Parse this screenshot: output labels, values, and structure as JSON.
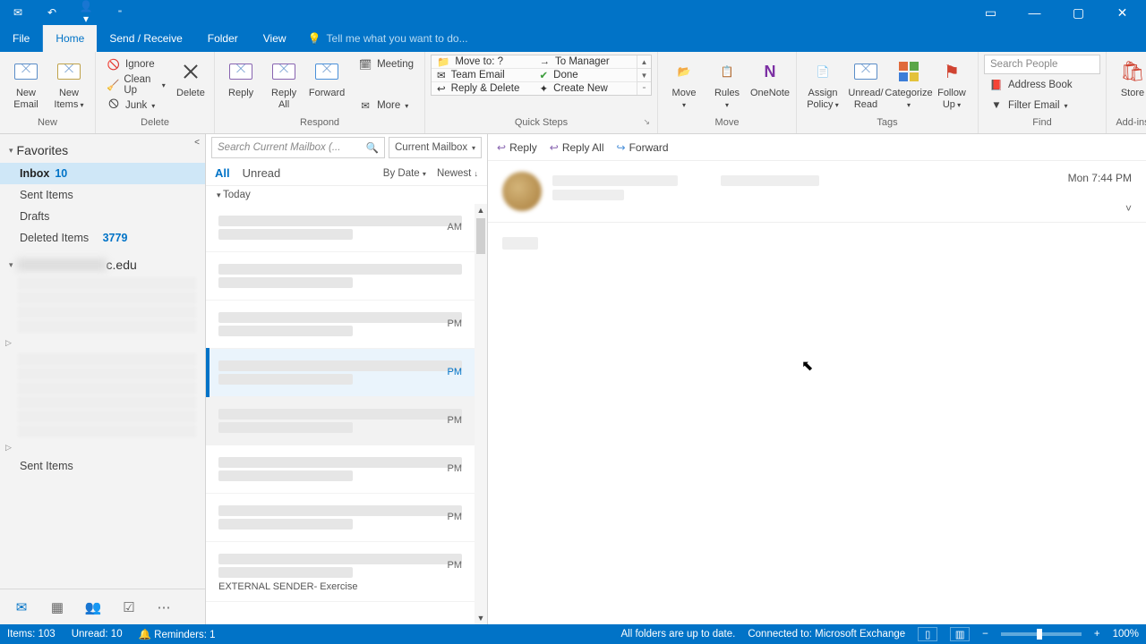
{
  "titlebar": {
    "app_hint": "Outlook"
  },
  "ribbon": {
    "file": "File",
    "tabs": [
      {
        "label": "Home",
        "active": true
      },
      {
        "label": "Send / Receive"
      },
      {
        "label": "Folder"
      },
      {
        "label": "View"
      }
    ],
    "tellme": "Tell me what you want to do..."
  },
  "groups": {
    "new": {
      "label": "New",
      "new_email": "New\nEmail",
      "new_items": "New\nItems"
    },
    "delete": {
      "label": "Delete",
      "ignore": "Ignore",
      "cleanup": "Clean Up",
      "junk": "Junk",
      "delete_btn": "Delete"
    },
    "respond": {
      "label": "Respond",
      "reply": "Reply",
      "reply_all": "Reply\nAll",
      "forward": "Forward",
      "meeting": "Meeting",
      "more": "More"
    },
    "quicksteps": {
      "label": "Quick Steps",
      "left": [
        "Move to: ?",
        "Team Email",
        "Reply & Delete"
      ],
      "right": [
        "To Manager",
        "Done",
        "Create New"
      ]
    },
    "move": {
      "label": "Move",
      "move": "Move",
      "rules": "Rules",
      "onenote": "OneNote"
    },
    "tags": {
      "label": "Tags",
      "assign": "Assign\nPolicy",
      "unread": "Unread/\nRead",
      "categorize": "Categorize",
      "follow": "Follow\nUp"
    },
    "find": {
      "label": "Find",
      "search_people": "Search People",
      "address_book": "Address Book",
      "filter": "Filter Email"
    },
    "addins": {
      "label": "Add-ins",
      "store": "Store"
    }
  },
  "nav": {
    "favorites": "Favorites",
    "items": [
      {
        "label": "Inbox",
        "count": "10",
        "bold": true,
        "selected": true
      },
      {
        "label": "Sent Items"
      },
      {
        "label": "Drafts"
      },
      {
        "label": "Deleted Items",
        "count": "3779"
      }
    ],
    "account_suffix": "c.edu",
    "overflow": "Sent Items"
  },
  "list": {
    "search_placeholder": "Search Current Mailbox (...",
    "scope": "Current Mailbox",
    "filters": {
      "all": "All",
      "unread": "Unread"
    },
    "sort": {
      "by": "By Date",
      "order": "Newest"
    },
    "today": "Today",
    "messages": [
      {
        "time": "AM"
      },
      {
        "time": ""
      },
      {
        "time": "PM"
      },
      {
        "time": "PM",
        "selected": true
      },
      {
        "time": "PM",
        "hover": true
      },
      {
        "time": "PM"
      },
      {
        "time": "PM"
      },
      {
        "time": "PM",
        "preview": "EXTERNAL SENDER- Exercise"
      }
    ]
  },
  "reading": {
    "actions": {
      "reply": "Reply",
      "reply_all": "Reply All",
      "forward": "Forward"
    },
    "timestamp": "Mon 7:44 PM"
  },
  "status": {
    "items": "Items: 103",
    "unread": "Unread: 10",
    "reminders": "Reminders: 1",
    "sync": "All folders are up to date.",
    "connected": "Connected to: Microsoft Exchange",
    "zoom": "100%"
  },
  "colors": {
    "accent": "#0173c7"
  }
}
